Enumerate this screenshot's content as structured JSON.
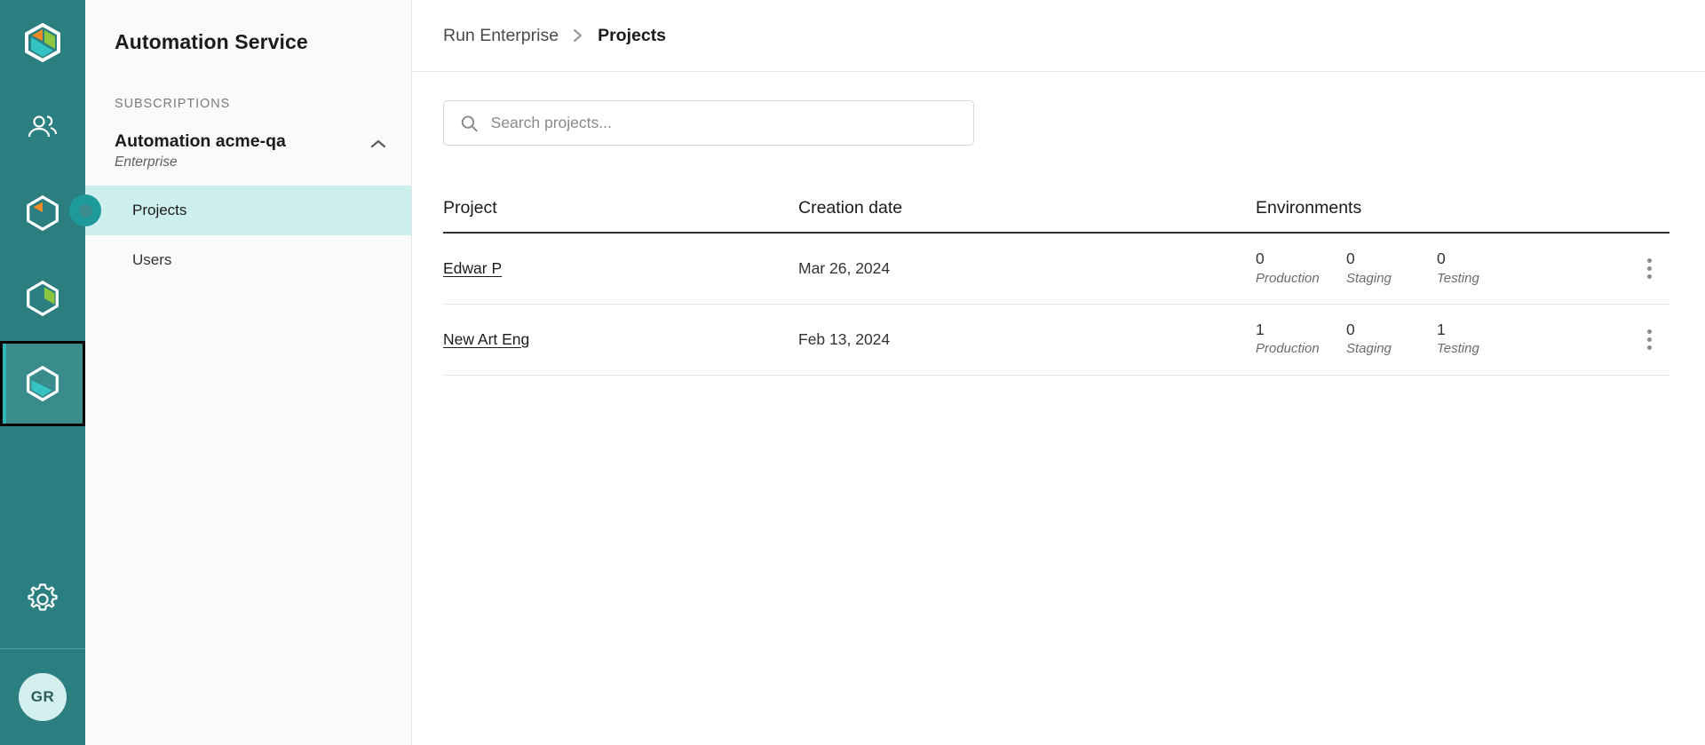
{
  "rail": {
    "logo": {
      "name": "app-logo",
      "icon": "hexagon-logo-icon"
    },
    "items": [
      {
        "icon": "users-group-icon",
        "name": "rail-item-users",
        "selected": false
      },
      {
        "icon": "hexagon-orange-icon",
        "name": "rail-item-subscriptions",
        "selected": false
      },
      {
        "icon": "hexagon-green-icon",
        "name": "rail-item-catalog",
        "selected": false
      },
      {
        "icon": "hexagon-teal-icon",
        "name": "rail-item-automation-service",
        "selected": true
      }
    ],
    "settings": {
      "icon": "gear-icon",
      "label": "Settings"
    },
    "avatar": {
      "initials": "GR"
    }
  },
  "nav": {
    "title": "Automation Service",
    "section_label": "SUBSCRIPTIONS",
    "subscription": {
      "name": "Automation acme-qa",
      "tier": "Enterprise",
      "collapse_icon": "chevron-up-icon"
    },
    "links": [
      {
        "label": "Projects",
        "active": true
      },
      {
        "label": "Users",
        "active": false
      }
    ]
  },
  "breadcrumb": {
    "parent": "Run Enterprise",
    "separator_icon": "chevron-right-icon",
    "current": "Projects"
  },
  "search": {
    "icon": "search-icon",
    "placeholder": "Search projects...",
    "value": ""
  },
  "table": {
    "headers": {
      "project": "Project",
      "creation_date": "Creation date",
      "environments": "Environments"
    },
    "rows": [
      {
        "project": "Edwar P",
        "creation_date": "Mar 26, 2024",
        "environments": [
          {
            "count": "0",
            "name": "Production"
          },
          {
            "count": "0",
            "name": "Staging"
          },
          {
            "count": "0",
            "name": "Testing"
          }
        ],
        "menu_icon": "kebab-menu-icon"
      },
      {
        "project": "New Art Eng",
        "creation_date": "Feb 13, 2024",
        "environments": [
          {
            "count": "1",
            "name": "Production"
          },
          {
            "count": "0",
            "name": "Staging"
          },
          {
            "count": "1",
            "name": "Testing"
          }
        ],
        "menu_icon": "kebab-menu-icon"
      }
    ]
  },
  "colors": {
    "rail_bg": "#2b7f80",
    "rail_selected_bg": "#3a8c8c",
    "nav_bg": "#fafafa",
    "nav_active_bg": "#cdefee",
    "accent_teal": "#1f9a9b",
    "avatar_bg": "#d3f0ef",
    "accent_orange": "#f08a24",
    "accent_green": "#8dc63f",
    "accent_cyan": "#35c4c4",
    "focus_yellow": "#ffe600"
  }
}
